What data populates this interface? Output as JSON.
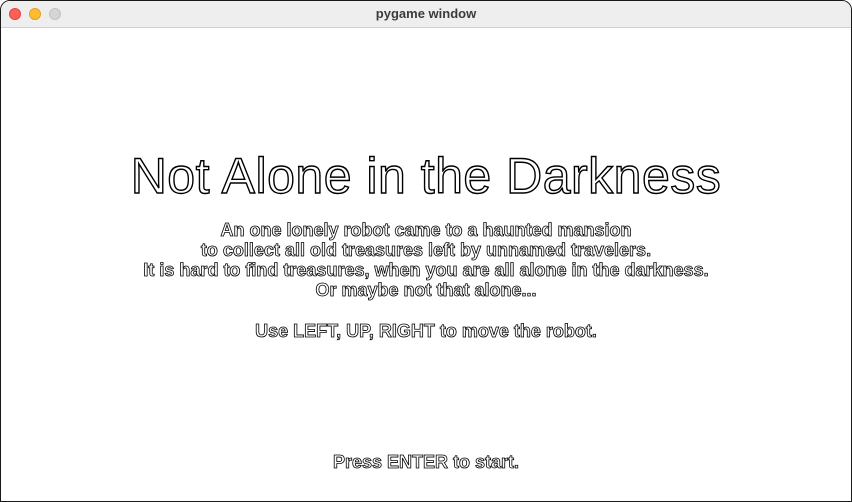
{
  "window": {
    "title": "pygame window"
  },
  "screen": {
    "title": "Not Alone in the Darkness",
    "story_lines": [
      "An one lonely robot came to a haunted mansion",
      "to collect all old treasures left by unnamed travelers.",
      "It is hard to find treasures, when you are all alone in the darkness.",
      "Or maybe not that alone..."
    ],
    "controls_hint": "Use LEFT, UP, RIGHT to move the robot.",
    "start_prompt": "Press ENTER to start."
  },
  "colors": {
    "text_fill": "#ffffff",
    "text_outline": "#000000",
    "background": "#ffffff"
  }
}
